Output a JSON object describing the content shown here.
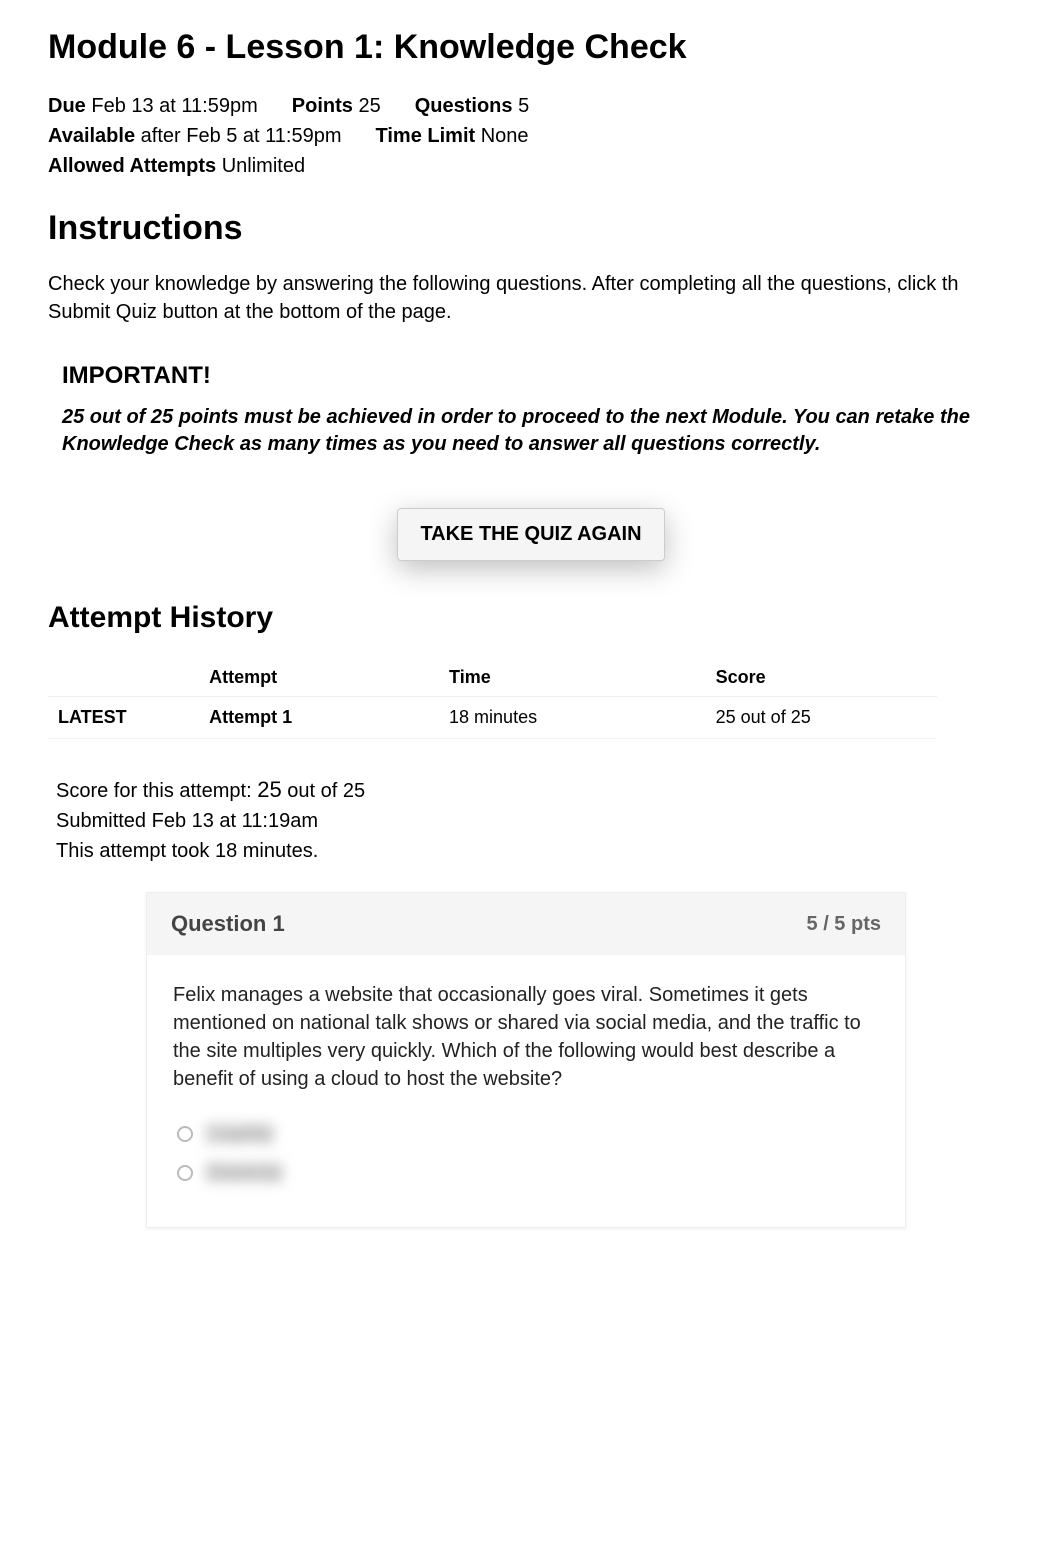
{
  "page_title": "Module 6 - Lesson 1: Knowledge Check",
  "meta": {
    "due_label": "Due",
    "due_value": "Feb 13 at 11:59pm",
    "points_label": "Points",
    "points_value": "25",
    "questions_label": "Questions",
    "questions_value": "5",
    "available_label": "Available",
    "available_value": "after Feb 5 at 11:59pm",
    "time_limit_label": "Time Limit",
    "time_limit_value": "None",
    "allowed_attempts_label": "Allowed Attempts",
    "allowed_attempts_value": "Unlimited"
  },
  "instructions_heading": "Instructions",
  "instructions_text": "Check your knowledge by answering the following questions. After completing all the questions, click th Submit Quiz button at the bottom of the page.",
  "important_heading": "IMPORTANT!",
  "important_body": "25 out of 25 points must be achieved in order to proceed to the next Module. You can retake the Knowledge Check as many times as you need to answer all questions correctly.",
  "take_again_label": "TAKE THE QUIZ AGAIN",
  "history_heading": "Attempt History",
  "history_headers": {
    "blank": "",
    "attempt": "Attempt",
    "time": "Time",
    "score": "Score"
  },
  "history_row": {
    "latest": "LATEST",
    "attempt": "Attempt 1",
    "time": "18 minutes",
    "score": "25 out of 25"
  },
  "score_block": {
    "prefix": "Score for this attempt: ",
    "score": "25",
    "suffix": " out of 25",
    "submitted": "Submitted Feb 13 at 11:19am",
    "duration": "This attempt took 18 minutes."
  },
  "question": {
    "title": "Question 1",
    "pts": "5 / 5 pts",
    "body": "Felix manages a website that occasionally goes viral. Sometimes it gets mentioned on national talk shows or shared via social media, and the traffic to the site multiples very quickly. Which of the following would best describe a benefit of using a cloud to host the website?",
    "answer1": "Legality",
    "answer2": "Elasticity"
  }
}
